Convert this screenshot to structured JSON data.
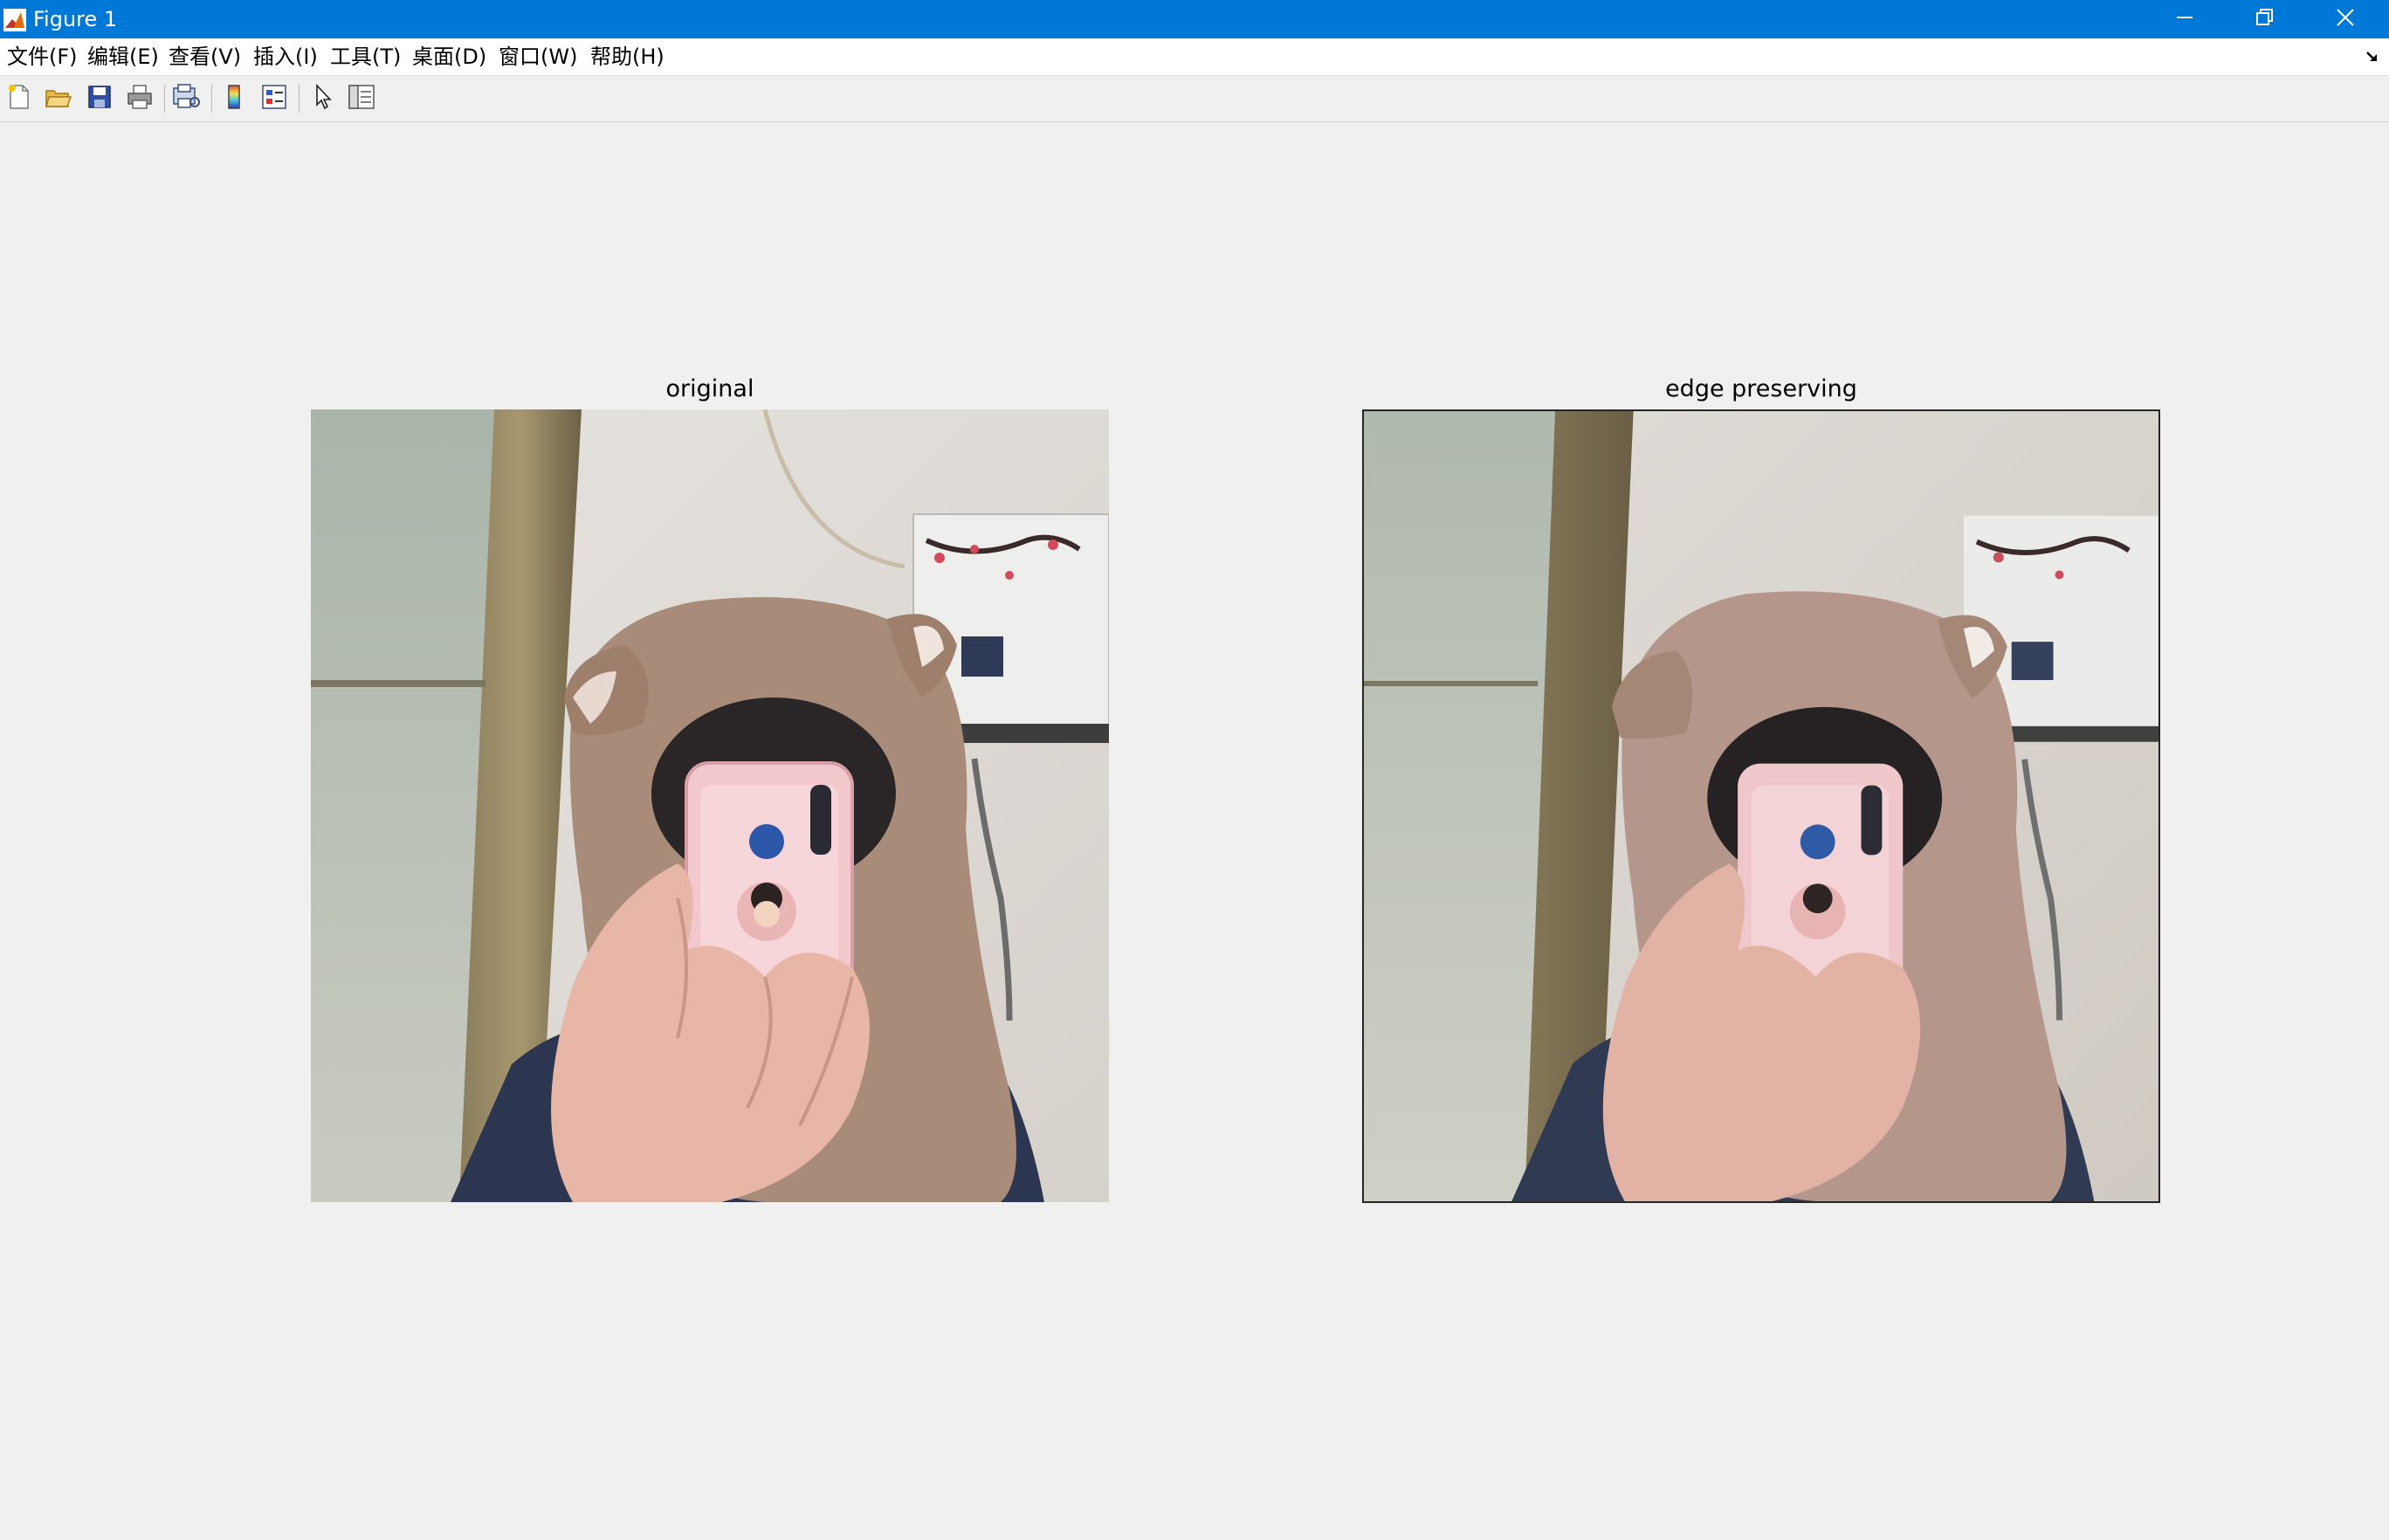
{
  "window": {
    "title": "Figure 1",
    "controls": [
      "minimize-icon",
      "restore-icon",
      "close-icon"
    ]
  },
  "menubar": {
    "items": [
      {
        "label": "文件(F)"
      },
      {
        "label": "编辑(E)"
      },
      {
        "label": "查看(V)"
      },
      {
        "label": "插入(I)"
      },
      {
        "label": "工具(T)"
      },
      {
        "label": "桌面(D)"
      },
      {
        "label": "窗口(W)"
      },
      {
        "label": "帮助(H)"
      }
    ]
  },
  "toolbar": {
    "buttons": [
      "new-figure-icon",
      "open-file-icon",
      "save-icon",
      "print-icon",
      "print-preview-icon",
      "colorbar-icon",
      "legend-icon",
      "edit-plot-arrow-icon",
      "property-inspector-icon"
    ]
  },
  "figure": {
    "subplots": [
      {
        "title": "original",
        "content": "photo-original"
      },
      {
        "title": "edge preserving",
        "content": "photo-edge-preserving-filtered"
      }
    ]
  },
  "colors": {
    "titlebar": "#0078d7",
    "figure_background": "#f0f0f0"
  }
}
